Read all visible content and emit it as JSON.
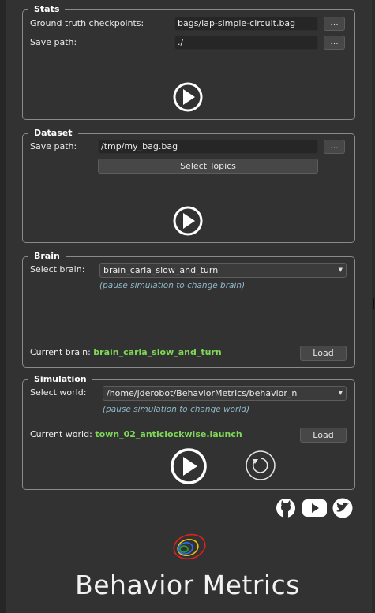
{
  "stats": {
    "title": "Stats",
    "ground_truth_label": "Ground truth checkpoints:",
    "ground_truth_value": "bags/lap-simple-circuit.bag",
    "save_path_label": "Save path:",
    "save_path_value": "./",
    "browse_label": "..."
  },
  "dataset": {
    "title": "Dataset",
    "save_path_label": "Save path:",
    "save_path_value": "/tmp/my_bag.bag",
    "browse_label": "...",
    "select_topics_label": "Select Topics"
  },
  "brain": {
    "title": "Brain",
    "select_label": "Select brain:",
    "selected_brain": "brain_carla_slow_and_turn",
    "hint": "(pause simulation to change brain)",
    "current_label": "Current brain:",
    "current_value": "brain_carla_slow_and_turn",
    "load_label": "Load"
  },
  "simulation": {
    "title": "Simulation",
    "select_label": "Select world:",
    "selected_world": "/home/jderobot/BehaviorMetrics/behavior_n",
    "hint": "(pause simulation to change world)",
    "current_label": "Current world:",
    "current_value": "town_02_anticlockwise.launch",
    "load_label": "Load"
  },
  "social_icons": [
    "github-icon",
    "youtube-icon",
    "twitter-icon"
  ],
  "footer": {
    "app_title": "Behavior Metrics"
  },
  "colors": {
    "background": "#323232",
    "field_bg": "#262626",
    "accent_green": "#7ed957",
    "hint_blue": "#8fb8c8",
    "logo_red": "#e02020"
  }
}
